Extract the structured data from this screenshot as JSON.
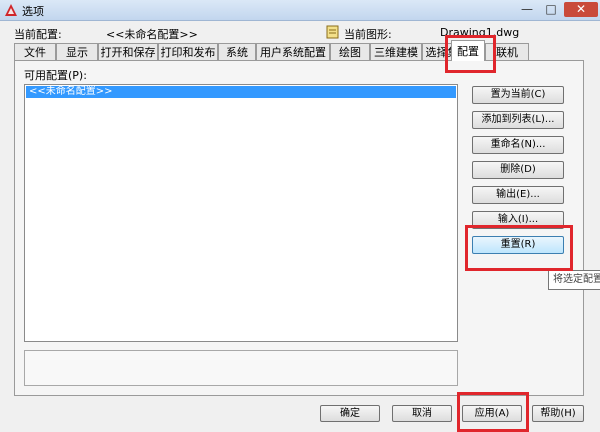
{
  "window": {
    "title": "选项",
    "controls": {
      "minimize": "—",
      "maximize": "□",
      "close": "✕"
    }
  },
  "header": {
    "current_profile_label": "当前配置:",
    "current_profile_value": "<<未命名配置>>",
    "current_drawing_label": "当前图形:",
    "current_drawing_value": "Drawing1.dwg"
  },
  "tabs": [
    {
      "label": "文件"
    },
    {
      "label": "显示"
    },
    {
      "label": "打开和保存"
    },
    {
      "label": "打印和发布"
    },
    {
      "label": "系统"
    },
    {
      "label": "用户系统配置"
    },
    {
      "label": "绘图"
    },
    {
      "label": "三维建模"
    },
    {
      "label": "选择集"
    },
    {
      "label": "配置",
      "active": true
    },
    {
      "label": "联机"
    }
  ],
  "profiles": {
    "label": "可用配置(P):",
    "items": [
      "<<未命名配置>>"
    ]
  },
  "side_buttons": {
    "set_current": "置为当前(C)",
    "add_to_list": "添加到列表(L)...",
    "rename": "重命名(N)...",
    "delete": "删除(D)",
    "export": "输出(E)...",
    "import": "输入(I)...",
    "reset": "重置(R)"
  },
  "tooltip": "将选定配置",
  "footer": {
    "ok": "确定",
    "cancel": "取消",
    "apply": "应用(A)",
    "help": "帮助(H)"
  },
  "colors": {
    "highlight": "#e0262c",
    "selection": "#3399ff"
  }
}
